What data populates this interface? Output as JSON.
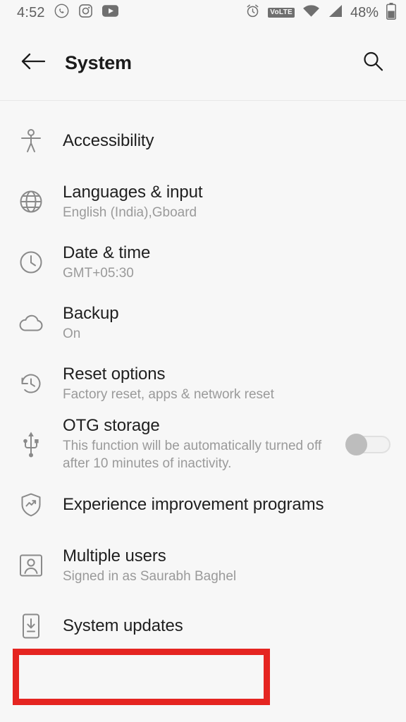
{
  "status_bar": {
    "time": "4:52",
    "battery_percent": "48%",
    "left_icons": [
      "whatsapp-icon",
      "instagram-icon",
      "youtube-icon"
    ],
    "right_icons": [
      "alarm-icon",
      "volte-badge",
      "wifi-icon",
      "signal-icon",
      "battery-icon"
    ],
    "volte_label": "VoLTE"
  },
  "app_bar": {
    "title": "System",
    "back_icon": "back-arrow-icon",
    "search_icon": "search-icon"
  },
  "settings": {
    "items": [
      {
        "icon": "accessibility-icon",
        "title": "Accessibility",
        "subtitle": "",
        "toggle": null
      },
      {
        "icon": "globe-icon",
        "title": "Languages & input",
        "subtitle": "English (India),Gboard",
        "toggle": null
      },
      {
        "icon": "clock-icon",
        "title": "Date & time",
        "subtitle": "GMT+05:30",
        "toggle": null
      },
      {
        "icon": "cloud-icon",
        "title": "Backup",
        "subtitle": "On",
        "toggle": null
      },
      {
        "icon": "history-icon",
        "title": "Reset options",
        "subtitle": "Factory reset, apps & network reset",
        "toggle": null
      },
      {
        "icon": "usb-otg-icon",
        "title": "OTG storage",
        "subtitle": "This function will be automatically turned off after 10 minutes of inactivity.",
        "toggle": "off"
      },
      {
        "icon": "shield-trending-icon",
        "title": "Experience improvement programs",
        "subtitle": "",
        "toggle": null
      },
      {
        "icon": "user-account-icon",
        "title": "Multiple users",
        "subtitle": "Signed in as Saurabh Baghel",
        "toggle": null
      },
      {
        "icon": "system-update-icon",
        "title": "System updates",
        "subtitle": "",
        "toggle": null
      }
    ]
  },
  "annotation": {
    "highlight_color": "#e52521",
    "highlight_target": "System updates"
  }
}
